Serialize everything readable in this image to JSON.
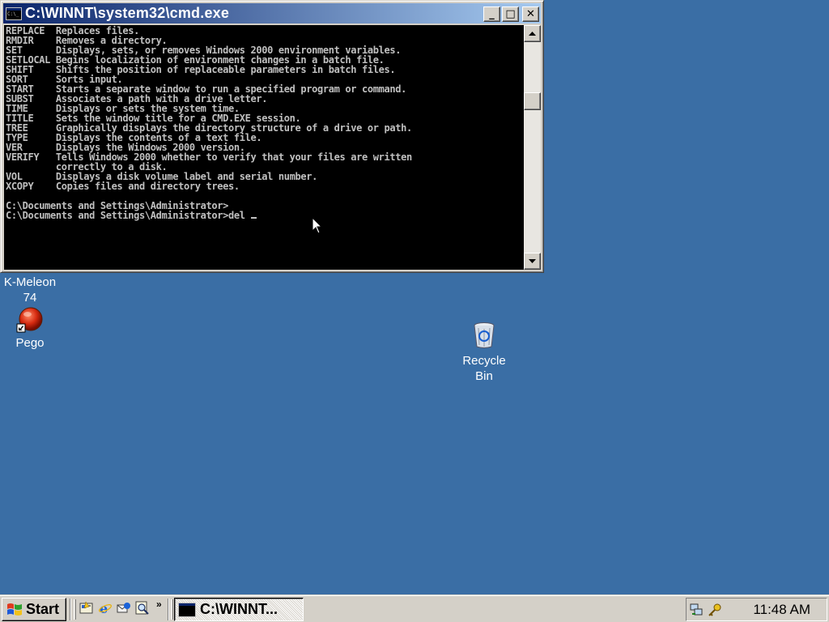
{
  "window": {
    "title": "C:\\WINNT\\system32\\cmd.exe",
    "minimize_glyph": "_",
    "maximize_glyph": "□",
    "close_glyph": "✕"
  },
  "console": {
    "lines": [
      "REPLACE  Replaces files.",
      "RMDIR    Removes a directory.",
      "SET      Displays, sets, or removes Windows 2000 environment variables.",
      "SETLOCAL Begins localization of environment changes in a batch file.",
      "SHIFT    Shifts the position of replaceable parameters in batch files.",
      "SORT     Sorts input.",
      "START    Starts a separate window to run a specified program or command.",
      "SUBST    Associates a path with a drive letter.",
      "TIME     Displays or sets the system time.",
      "TITLE    Sets the window title for a CMD.EXE session.",
      "TREE     Graphically displays the directory structure of a drive or path.",
      "TYPE     Displays the contents of a text file.",
      "VER      Displays the Windows 2000 version.",
      "VERIFY   Tells Windows 2000 whether to verify that your files are written",
      "         correctly to a disk.",
      "VOL      Displays a disk volume label and serial number.",
      "XCOPY    Copies files and directory trees.",
      "",
      "C:\\Documents and Settings\\Administrator>"
    ],
    "prompt": "C:\\Documents and Settings\\Administrator>",
    "current_input": "del "
  },
  "desktop": {
    "icons": [
      {
        "label": "K-Meleon\n74",
        "icon": "k-meleon-icon"
      },
      {
        "label": "Pego",
        "icon": "pego-icon"
      },
      {
        "label": "Recycle\nBin",
        "icon": "recycle-bin-icon"
      }
    ]
  },
  "taskbar": {
    "start_label": "Start",
    "quick_launch": [
      "show-desktop-icon",
      "internet-explorer-icon",
      "outlook-express-icon",
      "search-icon"
    ],
    "more_glyph": "»",
    "tasks": [
      {
        "label": "C:\\WINNT...",
        "icon": "cmd-icon",
        "active": true
      }
    ],
    "tray_icons": [
      "network-icon",
      "security-key-icon"
    ],
    "clock": "11:48 AM"
  },
  "colors": {
    "desktop": "#3a6ea5",
    "titlebar_start": "#0a246a",
    "titlebar_end": "#a6caf0",
    "console_bg": "#000000",
    "console_fg": "#c0c0c0",
    "chrome": "#d4d0c8"
  }
}
